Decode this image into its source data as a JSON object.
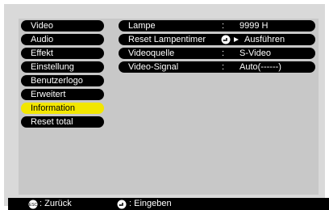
{
  "menu": {
    "items": [
      {
        "label": "Video"
      },
      {
        "label": "Audio"
      },
      {
        "label": "Effekt"
      },
      {
        "label": "Einstellung"
      },
      {
        "label": "Benutzerlogo"
      },
      {
        "label": "Erweitert"
      },
      {
        "label": "Information",
        "selected": true
      },
      {
        "label": "Reset total"
      }
    ]
  },
  "info": {
    "rows": [
      {
        "label": "Lampe",
        "separator": ":",
        "value": "9999 H"
      },
      {
        "label": "Reset Lampentimer",
        "value": "Ausführen"
      },
      {
        "label": "Videoquelle",
        "separator": ":",
        "value": "S-Video"
      },
      {
        "label": "Video-Signal",
        "separator": ":",
        "value": "Auto(------)"
      }
    ]
  },
  "footer": {
    "back_label": ": Zurück",
    "enter_label": ": Eingeben"
  },
  "colors": {
    "selected": "#f2e600",
    "bar": "#000000",
    "panel": "#c8c8c8"
  },
  "icons": {
    "back": "esc-icon",
    "enter": "enter-icon"
  }
}
